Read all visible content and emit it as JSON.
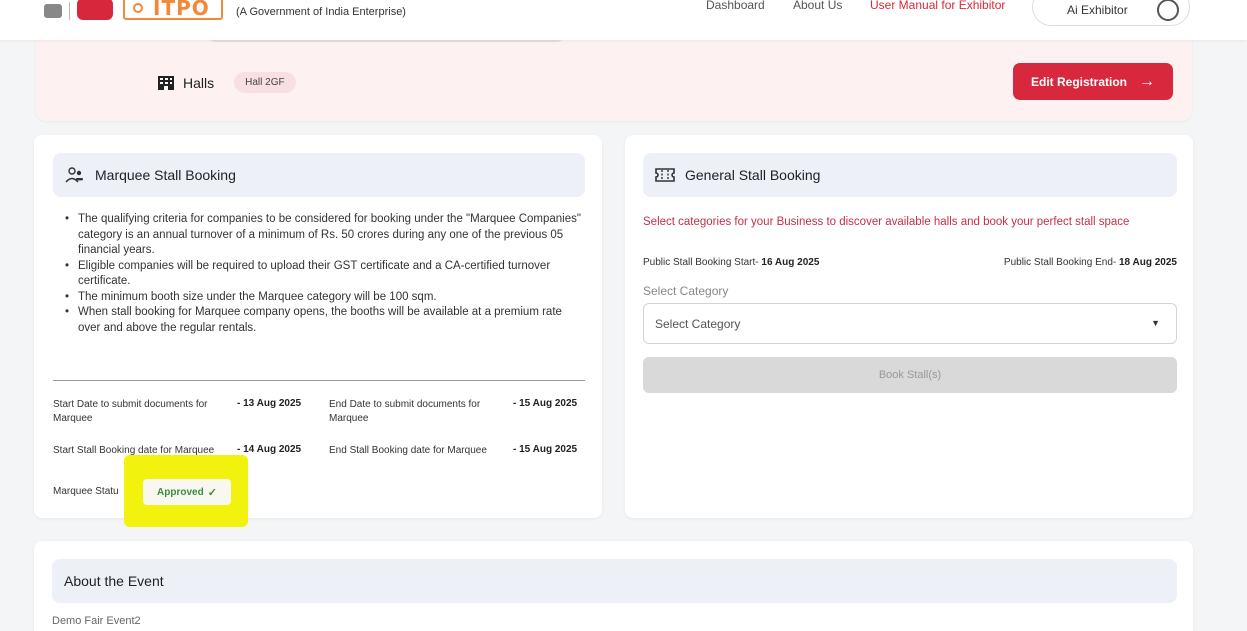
{
  "header": {
    "tagline": "(A Government of India Enterprise)",
    "logo_text": "ITPO",
    "nav": [
      "Dashboard",
      "About Us",
      "User Manual for Exhibitor"
    ],
    "user_name": "Ai Exhibitor"
  },
  "hero": {
    "halls_label": "Halls",
    "hall_chip": "Hall 2GF",
    "edit_button": "Edit Registration"
  },
  "marquee": {
    "title": "Marquee Stall Booking",
    "bullets": [
      "The qualifying criteria for companies to be considered for booking under the \"Marquee Companies\" category is an annual turnover of a minimum of Rs. 50 crores during any one of the previous 05 financial years.",
      "Eligible companies will be required to upload their GST certificate and a CA-certified turnover certificate.",
      "The minimum booth size under the Marquee category will be 100 sqm.",
      "When stall booking for Marquee company opens, the booths will be available at a premium rate over and above the regular rentals."
    ],
    "dates": {
      "start_docs_label": "Start Date to submit documents for Marquee",
      "start_docs_value": "- 13 Aug 2025",
      "end_docs_label": "End Date to submit documents for Marquee",
      "end_docs_value": "- 15 Aug 2025",
      "start_booking_label": "Start Stall Booking date for Marquee",
      "start_booking_value": "- 14 Aug 2025",
      "end_booking_label": "End Stall Booking date for Marquee",
      "end_booking_value": "- 15 Aug 2025"
    },
    "status_label": "Marquee Statu",
    "status_value": "Approved"
  },
  "general": {
    "title": "General Stall Booking",
    "promo": "Select categories for your Business to discover available halls and book your perfect stall space",
    "public_start_label": "Public Stall Booking Start-",
    "public_start_value": "16 Aug 2025",
    "public_end_label": "Public Stall Booking End-",
    "public_end_value": "18 Aug 2025",
    "select_label": "Select Category",
    "select_value": "Select Category",
    "book_button": "Book Stall(s)"
  },
  "about": {
    "title": "About the Event",
    "text": "Demo Fair Event2"
  },
  "colors": {
    "brand_red": "#d8283e",
    "hero_bg": "#fdf1f2",
    "approved_green": "#3c8a3e",
    "highlight_yellow": "#f2f20f"
  }
}
